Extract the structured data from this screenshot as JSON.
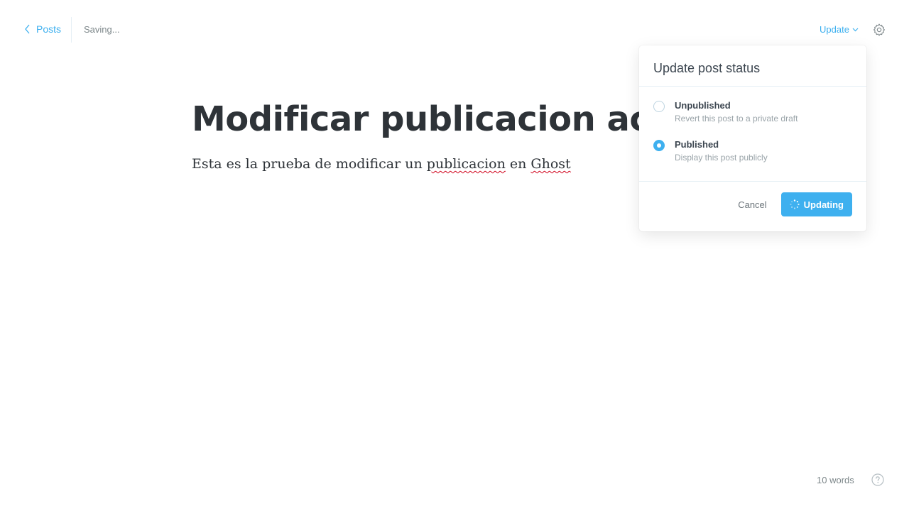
{
  "nav": {
    "back_label": "Posts",
    "status_text": "Saving...",
    "update_label": "Update",
    "settings_icon": "gear-icon"
  },
  "editor": {
    "title": "Modificar publicacion actualizada",
    "body_parts": [
      "Esta es la prueba de modificar un ",
      "publicacion",
      " en ",
      "Ghost"
    ]
  },
  "popover": {
    "header": "Update post status",
    "options": [
      {
        "title": "Unpublished",
        "description": "Revert this post to a private draft",
        "selected": false
      },
      {
        "title": "Published",
        "description": "Display this post publicly",
        "selected": true
      }
    ],
    "cancel_label": "Cancel",
    "submit_label": "Updating"
  },
  "footer": {
    "word_count": "10 words",
    "help_icon": "question-icon"
  },
  "colors": {
    "accent": "#3eb0ef",
    "text_dark": "#2e3338",
    "muted": "#7d878a"
  }
}
